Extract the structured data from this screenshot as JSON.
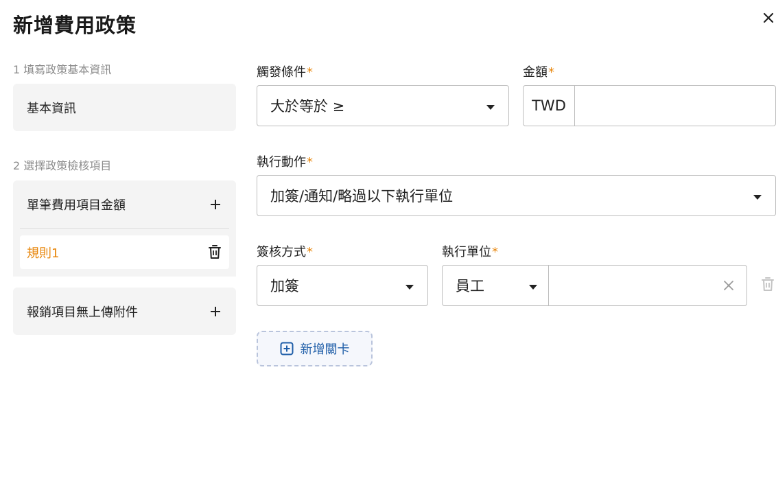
{
  "dialog": {
    "title": "新增費用政策"
  },
  "sidebar": {
    "step1_label": "1 填寫政策基本資訊",
    "basic_info": "基本資訊",
    "step2_label": "2 選擇政策檢核項目",
    "single_amount": "單筆費用項目金額",
    "rule1": "規則1",
    "attachment": "報銷項目無上傳附件"
  },
  "form": {
    "trigger_label": "觸發條件",
    "trigger_value": "大於等於 ≥",
    "amount_label": "金額",
    "currency": "TWD",
    "amount_value": "",
    "action_label": "執行動作",
    "action_value": "加簽/通知/略過以下執行單位",
    "approval_label": "簽核方式",
    "approval_value": "加簽",
    "unit_label": "執行單位",
    "unit_type": "員工",
    "add_gate": "新增關卡",
    "required_mark": "*"
  },
  "colors": {
    "accent": "#e8870d",
    "link": "#1f5ea8"
  }
}
